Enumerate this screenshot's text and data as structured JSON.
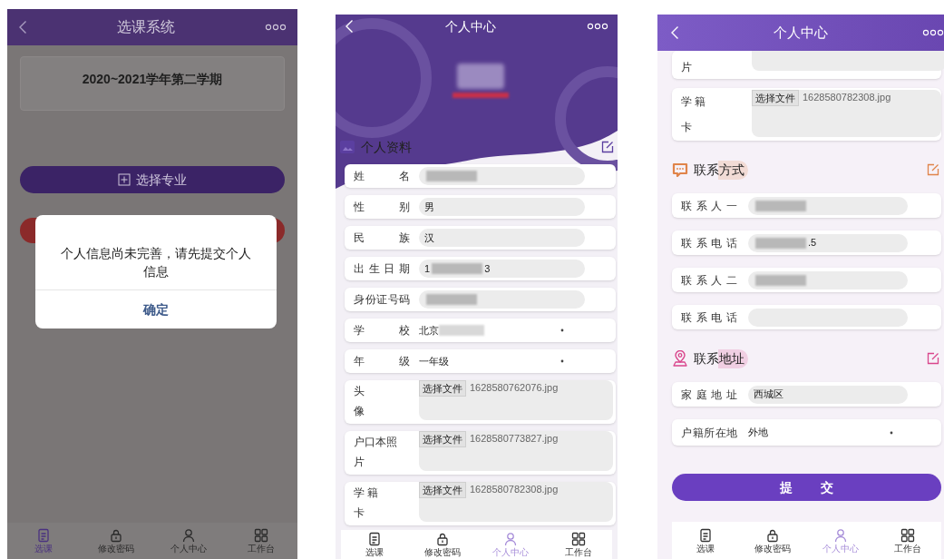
{
  "screens": [
    {
      "kind": "course",
      "title": "选课系统",
      "term": "2020~2021学年第二学期",
      "major_button": "选择专业",
      "dialog": {
        "message": "个人信息尚未完善，请先提交个人信息",
        "confirm": "确定"
      },
      "nav": [
        {
          "label": "选课",
          "selected": true
        },
        {
          "label": "修改密码",
          "selected": false
        },
        {
          "label": "个人中心",
          "selected": false
        },
        {
          "label": "工作台",
          "selected": false
        }
      ]
    },
    {
      "kind": "profile",
      "title": "个人中心",
      "scrolled": false,
      "sections": [
        {
          "kind": "profile",
          "title": "个人资料",
          "color": "#5b3fa0",
          "rows": [
            {
              "kind": "input",
              "label": "姓 名",
              "redacted": true
            },
            {
              "kind": "input",
              "label": "性 别",
              "value": "男"
            },
            {
              "kind": "input",
              "label": "民 族",
              "value": "汉"
            },
            {
              "kind": "input",
              "label": "出生日期",
              "value": "1",
              "value_after": "3",
              "redacted": true
            },
            {
              "kind": "input",
              "label": "身份证号码",
              "redacted": true
            },
            {
              "kind": "select",
              "label": "学 校",
              "value": "北京",
              "redacted": true
            },
            {
              "kind": "select",
              "label": "年 级",
              "value": "一年级"
            },
            {
              "kind": "file",
              "label": [
                "头",
                "像"
              ],
              "button": "选择文件",
              "file": "1628580762076.jpg"
            },
            {
              "kind": "file",
              "label": [
                "户口本照",
                "片"
              ],
              "button": "选择文件",
              "file": "1628580773827.jpg"
            },
            {
              "kind": "file",
              "label": [
                "学 籍",
                "卡"
              ],
              "button": "选择文件",
              "file": "1628580782308.jpg"
            }
          ]
        }
      ],
      "nav": [
        {
          "label": "选课",
          "selected": false
        },
        {
          "label": "修改密码",
          "selected": false
        },
        {
          "label": "个人中心",
          "selected": true
        },
        {
          "label": "工作台",
          "selected": false
        }
      ]
    },
    {
      "kind": "profile",
      "title": "个人中心",
      "scrolled": true,
      "sections": [
        {
          "kind": "continued",
          "rows": [
            {
              "kind": "file_tail",
              "label": [
                "片"
              ]
            },
            {
              "kind": "file",
              "label": [
                "学 籍",
                "卡"
              ],
              "button": "选择文件",
              "file": "1628580782308.jpg"
            }
          ]
        },
        {
          "kind": "contact",
          "title": "联系方式",
          "color": "#e0844a",
          "rows": [
            {
              "kind": "input",
              "label": "联系人一",
              "redacted": true
            },
            {
              "kind": "input",
              "label": "联系电话",
              "value_after": ".5",
              "redacted": true
            },
            {
              "kind": "input",
              "label": "联系人二",
              "redacted": true
            },
            {
              "kind": "input",
              "label": "联系电话"
            }
          ]
        },
        {
          "kind": "address",
          "title": "联系地址",
          "color": "#d9468c",
          "rows": [
            {
              "kind": "input",
              "label": "家庭地址",
              "value": "西城区"
            },
            {
              "kind": "select",
              "label": "户籍所在地",
              "value": "外地"
            }
          ]
        }
      ],
      "submit": "提 交",
      "nav": [
        {
          "label": "选课",
          "selected": false
        },
        {
          "label": "修改密码",
          "selected": false
        },
        {
          "label": "个人中心",
          "selected": true
        },
        {
          "label": "工作台",
          "selected": false
        }
      ]
    }
  ]
}
